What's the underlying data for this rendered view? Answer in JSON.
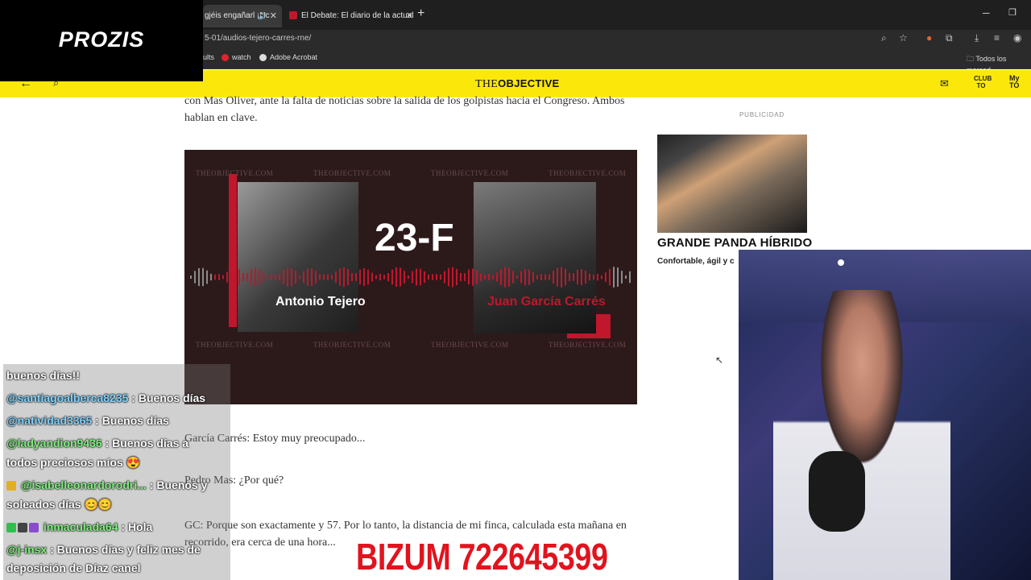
{
  "browser": {
    "tabs": [
      {
        "label": "gjéis engañarl ¡Nc",
        "active": true
      },
      {
        "label": "El Debate: El diario de la actual",
        "active": false
      }
    ],
    "url": "5-01/audios-tejero-carres-rne/",
    "bookmarks": [
      {
        "label": "ults"
      },
      {
        "label": "watch"
      },
      {
        "label": "Adobe Acrobat"
      }
    ],
    "bookmarks_right": "Todos los marcad"
  },
  "overlay": {
    "brand": "PROZIS",
    "bizum": "BIZUM 722645399"
  },
  "site": {
    "logo_prefix": "THE",
    "logo_bold": "OBJECTIVE",
    "club_label": "CLUB TO",
    "my_label": "My TO"
  },
  "article": {
    "para1": "con Mas Oliver, ante la falta de noticias sobre la salida de los golpistas hacia el Congreso. Ambos hablan en clave.",
    "hero": {
      "title": "23-F",
      "watermark": "THEOBJECTIVE.COM",
      "name_left": "Antonio Tejero",
      "name_right": "Juan García Carrés"
    },
    "para2": "García Carrés: Estoy muy preocupado...",
    "para3": "Pedro Mas: ¿Por qué?",
    "para4": "GC: Porque son exactamente y 57. Por lo tanto, la distancia de mi finca, calculada esta mañana en recorrido, era cerca de una hora..."
  },
  "ad": {
    "label": "PUBLICIDAD",
    "title": "GRANDE PANDA HÍBRIDO",
    "subtitle": "Confortable, ágil y c"
  },
  "chat": [
    {
      "user": "",
      "message": "buenos días!!"
    },
    {
      "user": "@santiagoalberca8235",
      "message": ": Buenos días"
    },
    {
      "user": "@natividad3365",
      "message": ": Buenos días"
    },
    {
      "user": "@ladyandion9436",
      "message": ": Buenos días a"
    },
    {
      "user": "",
      "message": "todos preciosos míos 😍"
    },
    {
      "user": "@isabelleonardorodri...",
      "message": ": Buenos y"
    },
    {
      "user": "",
      "message": "soleados días 😊😊"
    },
    {
      "user": "inmaculada64",
      "message": ": Hola"
    },
    {
      "user": "@j-insx",
      "message": ": Buenos días y feliz mes de"
    },
    {
      "user": "",
      "message": "deposición de Díaz canel"
    }
  ],
  "colors": {
    "site_header": "#fbe80a",
    "accent_red": "#c0172c",
    "bizum_red": "#e0141e"
  }
}
